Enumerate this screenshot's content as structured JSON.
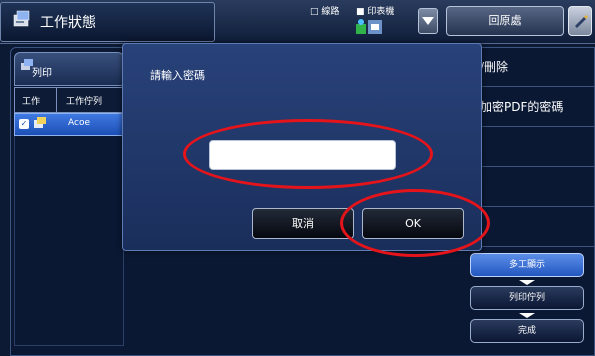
{
  "header": {
    "title": "工作狀態",
    "status_line1": "□ 線路",
    "status_line2": "■ 印表機",
    "home_label": "回原處"
  },
  "tab": {
    "label": "列印"
  },
  "job_table": {
    "columns": [
      "工作",
      "工作佇列"
    ],
    "rows": [
      {
        "name": "Acoe",
        "selected": true
      }
    ]
  },
  "right_panel": {
    "items": [
      "/刪除",
      "加密PDF的密碼"
    ],
    "buttons": [
      "多工顯示",
      "列印佇列",
      "完成"
    ]
  },
  "dialog": {
    "title": "請輸入密碼",
    "password_value": "",
    "cancel_label": "取消",
    "ok_label": "OK"
  },
  "colors": {
    "annotation": "#e5141b",
    "selected_row": "#2a63cc",
    "dialog_bg": "#223a6c"
  },
  "icons": [
    "job-status-icon",
    "print-tab-icon",
    "network-printer-icon",
    "dropdown-icon",
    "edit-icon",
    "checkbox-icon",
    "doc-icon"
  ]
}
